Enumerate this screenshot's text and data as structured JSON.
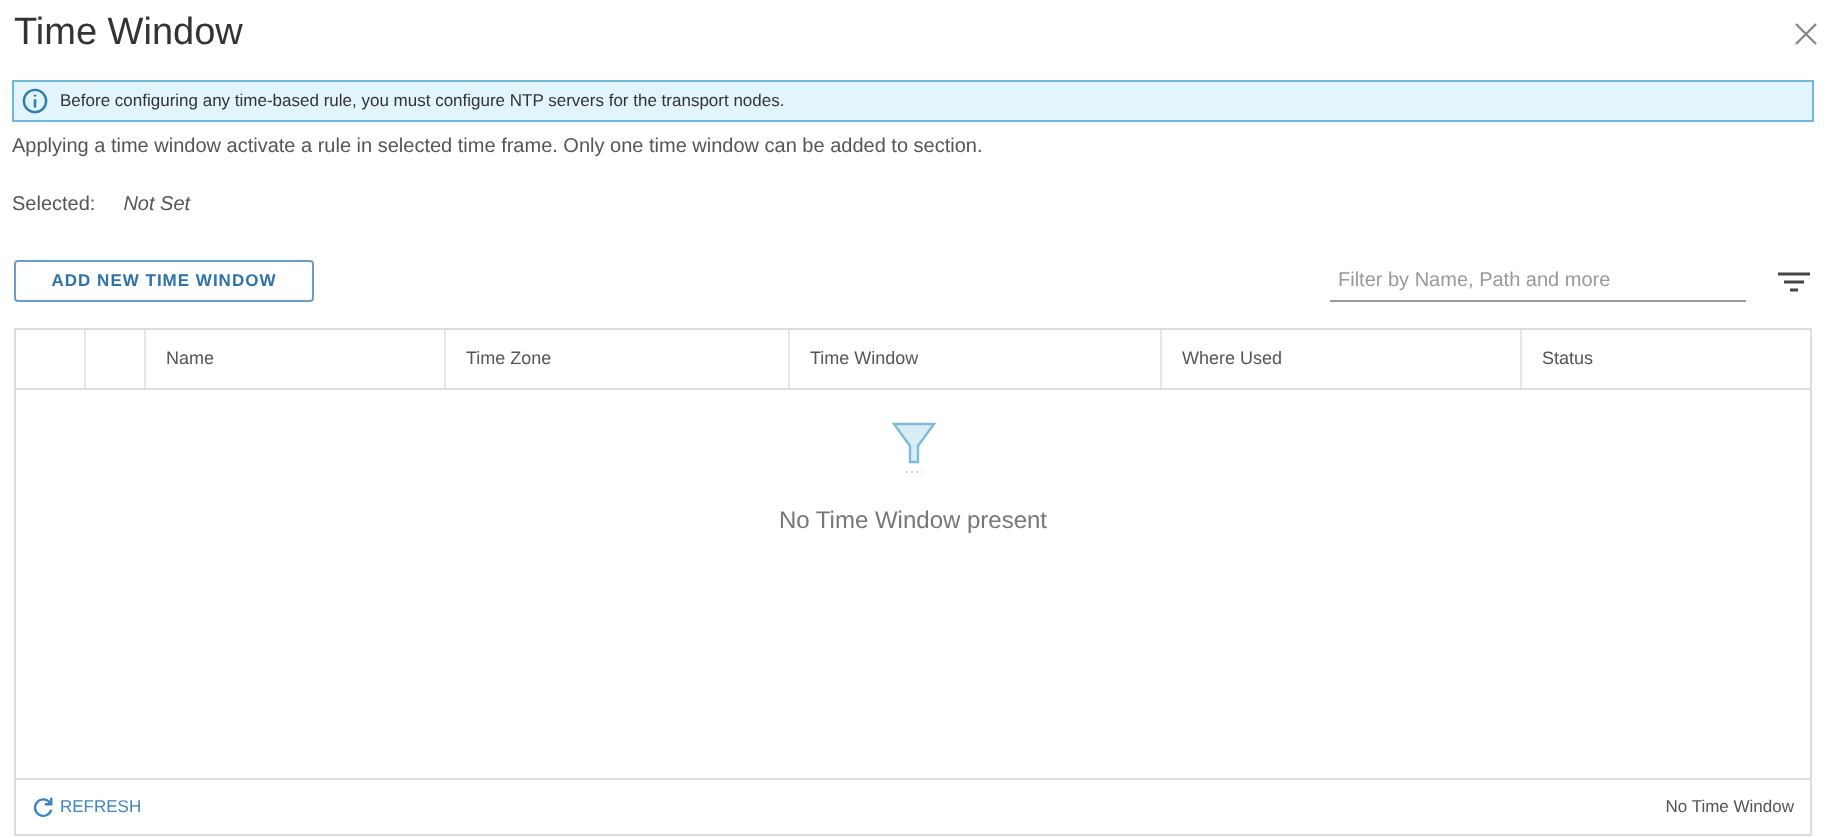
{
  "dialog": {
    "title": "Time Window"
  },
  "info_banner": {
    "text": "Before configuring any time-based rule, you must configure NTP servers for the transport nodes."
  },
  "description": "Applying a time window activate a rule in selected time frame. Only one time window can be added to section.",
  "selected": {
    "label": "Selected:",
    "value": "Not Set"
  },
  "add_button": "ADD NEW TIME WINDOW",
  "filter": {
    "placeholder": "Filter by Name, Path and more"
  },
  "table": {
    "columns": [
      "Name",
      "Time Zone",
      "Time Window",
      "Where Used",
      "Status"
    ],
    "empty_message": "No Time Window present"
  },
  "footer": {
    "refresh": "REFRESH",
    "count": "No Time Window"
  }
}
